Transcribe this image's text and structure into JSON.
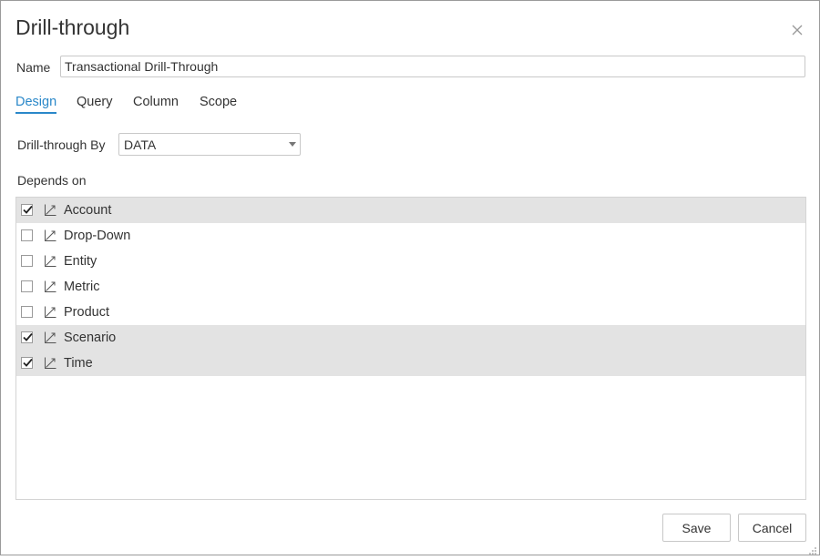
{
  "dialog": {
    "title": "Drill-through",
    "close_icon": "close-icon"
  },
  "name": {
    "label": "Name",
    "value": "Transactional Drill-Through"
  },
  "tabs": [
    {
      "label": "Design",
      "active": true
    },
    {
      "label": "Query",
      "active": false
    },
    {
      "label": "Column",
      "active": false
    },
    {
      "label": "Scope",
      "active": false
    }
  ],
  "drill_through_by": {
    "label": "Drill-through By",
    "selected": "DATA"
  },
  "depends_on": {
    "label": "Depends on",
    "items": [
      {
        "label": "Account",
        "checked": true,
        "icon": "dimension-icon"
      },
      {
        "label": "Drop-Down",
        "checked": false,
        "icon": "dimension-icon"
      },
      {
        "label": "Entity",
        "checked": false,
        "icon": "dimension-icon"
      },
      {
        "label": "Metric",
        "checked": false,
        "icon": "dimension-icon"
      },
      {
        "label": "Product",
        "checked": false,
        "icon": "dimension-icon"
      },
      {
        "label": "Scenario",
        "checked": true,
        "icon": "dimension-icon"
      },
      {
        "label": "Time",
        "checked": true,
        "icon": "dimension-icon"
      }
    ]
  },
  "footer": {
    "save_label": "Save",
    "cancel_label": "Cancel"
  },
  "colors": {
    "accent": "#2a88c9",
    "selected_row": "#e3e3e3",
    "border": "#c8c8c8"
  }
}
